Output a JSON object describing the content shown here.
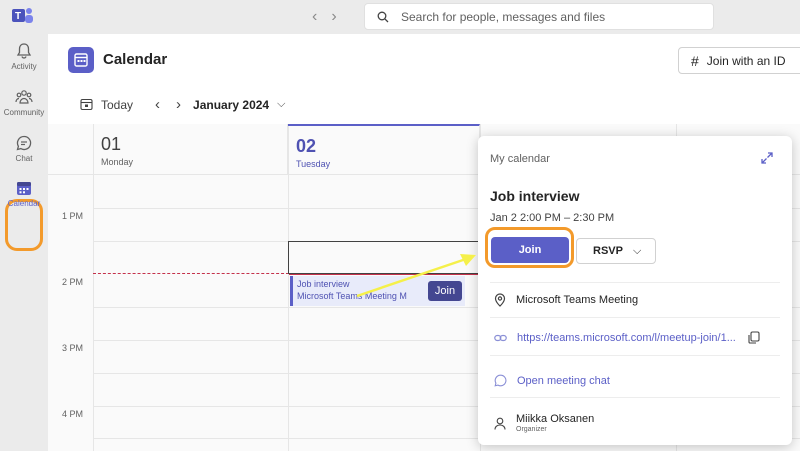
{
  "search": {
    "placeholder": "Search for people, messages and files"
  },
  "rail": {
    "items": [
      {
        "label": "Activity",
        "icon": "bell-icon"
      },
      {
        "label": "Community",
        "icon": "community-icon"
      },
      {
        "label": "Chat",
        "icon": "chat-icon"
      },
      {
        "label": "Calendar",
        "icon": "calendar-icon"
      }
    ]
  },
  "header": {
    "title": "Calendar",
    "join_id": "Join with an ID"
  },
  "toolbar": {
    "today": "Today",
    "month": "January 2024"
  },
  "days": [
    {
      "num": "01",
      "name": "Monday"
    },
    {
      "num": "02",
      "name": "Tuesday"
    }
  ],
  "times": [
    "1 PM",
    "2 PM",
    "3 PM",
    "4 PM"
  ],
  "event": {
    "title": "Job interview",
    "subtitle": "Microsoft Teams Meeting  M",
    "join": "Join"
  },
  "popup": {
    "calendar": "My calendar",
    "title": "Job interview",
    "time": "Jan 2 2:00 PM – 2:30 PM",
    "join": "Join",
    "rsvp": "RSVP",
    "location": "Microsoft Teams Meeting",
    "link": "https://teams.microsoft.com/l/meetup-join/1...",
    "open_chat": "Open meeting chat",
    "organizer_name": "Miikka Oksanen",
    "organizer_role": "Organizer"
  },
  "colors": {
    "accent": "#5b5fc7",
    "highlight": "#f39a2b",
    "arrow": "#f5f04a",
    "now": "#c4314b"
  }
}
